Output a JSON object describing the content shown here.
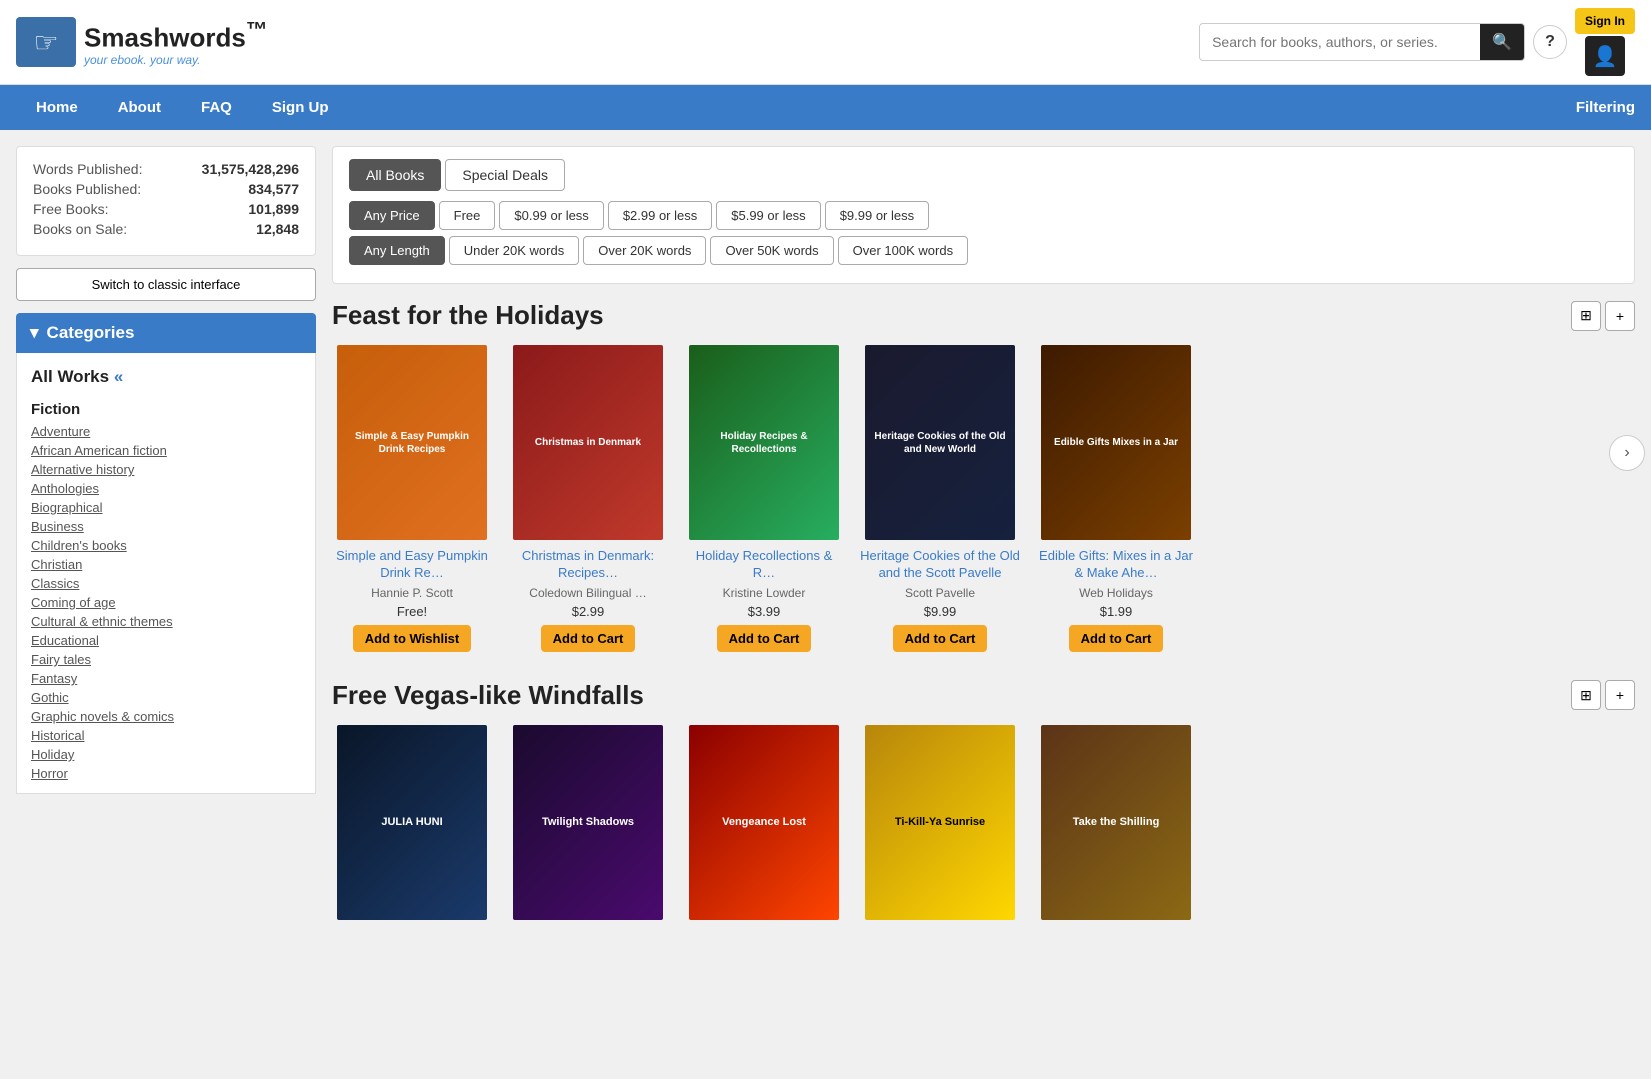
{
  "logo": {
    "title": "Smashwords",
    "tm": "™",
    "subtitle": "your ebook. your way."
  },
  "header": {
    "search_placeholder": "Search for books, authors, or series.",
    "signin_label": "Sign In"
  },
  "nav": {
    "items": [
      {
        "label": "Home",
        "id": "home"
      },
      {
        "label": "About",
        "id": "about"
      },
      {
        "label": "FAQ",
        "id": "faq"
      },
      {
        "label": "Sign Up",
        "id": "signup"
      }
    ],
    "right_label": "Filtering"
  },
  "sidebar": {
    "stats": [
      {
        "label": "Words Published:",
        "value": "31,575,428,296"
      },
      {
        "label": "Books Published:",
        "value": "834,577"
      },
      {
        "label": "Free Books:",
        "value": "101,899"
      },
      {
        "label": "Books on Sale:",
        "value": "12,848"
      }
    ],
    "classic_btn": "Switch to classic interface",
    "categories_title": "Categories",
    "all_works": "All Works «",
    "fiction_label": "Fiction",
    "categories": [
      "Adventure",
      "African American fiction",
      "Alternative history",
      "Anthologies",
      "Biographical",
      "Business",
      "Children's books",
      "Christian",
      "Classics",
      "Coming of age",
      "Cultural & ethnic themes",
      "Educational",
      "Fairy tales",
      "Fantasy",
      "Gothic",
      "Graphic novels & comics",
      "Historical",
      "Holiday",
      "Horror"
    ]
  },
  "filters": {
    "tabs": [
      {
        "label": "All Books",
        "active": true
      },
      {
        "label": "Special Deals",
        "active": false
      }
    ],
    "price": [
      {
        "label": "Any Price",
        "active": true
      },
      {
        "label": "Free",
        "active": false
      },
      {
        "label": "$0.99 or less",
        "active": false
      },
      {
        "label": "$2.99 or less",
        "active": false
      },
      {
        "label": "$5.99 or less",
        "active": false
      },
      {
        "label": "$9.99 or less",
        "active": false
      }
    ],
    "length": [
      {
        "label": "Any Length",
        "active": true
      },
      {
        "label": "Under 20K words",
        "active": false
      },
      {
        "label": "Over 20K words",
        "active": false
      },
      {
        "label": "Over 50K words",
        "active": false
      },
      {
        "label": "Over 100K words",
        "active": false
      }
    ]
  },
  "sections": [
    {
      "id": "feast-holidays",
      "title": "Feast for the Holidays",
      "books": [
        {
          "title": "Simple and Easy Pumpkin Drink Re…",
          "author": "Hannie P. Scott",
          "price": "Free!",
          "btn": "Add to Wishlist",
          "cover_class": "cover-orange",
          "cover_text": "Simple & Easy Pumpkin Drink Recipes"
        },
        {
          "title": "Christmas in Denmark: Recipes…",
          "author": "Coledown Bilingual …",
          "price": "$2.99",
          "btn": "Add to Cart",
          "cover_class": "cover-red",
          "cover_text": "Christmas in Denmark"
        },
        {
          "title": "Holiday Recollections & R…",
          "author": "Kristine Lowder",
          "price": "$3.99",
          "btn": "Add to Cart",
          "cover_class": "cover-green",
          "cover_text": "Holiday Recipes & Recollections"
        },
        {
          "title": "Heritage Cookies of the Old and the Scott Pavelle",
          "author": "Scott Pavelle",
          "price": "$9.99",
          "btn": "Add to Cart",
          "cover_class": "cover-dark",
          "cover_text": "Heritage Cookies of the Old and New World"
        },
        {
          "title": "Edible Gifts: Mixes in a Jar & Make Ahe…",
          "author": "Web Holidays",
          "price": "$1.99",
          "btn": "Add to Cart",
          "cover_class": "cover-brown",
          "cover_text": "Edible Gifts Mixes in a Jar"
        }
      ]
    },
    {
      "id": "free-vegas",
      "title": "Free Vegas-like Windfalls",
      "books": [
        {
          "title": "Julia Huni",
          "author": "",
          "price": "",
          "btn": "",
          "cover_class": "cover-blue-dark",
          "cover_text": "Julia Huni"
        },
        {
          "title": "Twilight Shadows",
          "author": "",
          "price": "",
          "btn": "",
          "cover_class": "cover-purple",
          "cover_text": "Twilight Shadows"
        },
        {
          "title": "Vengeance Lost",
          "author": "",
          "price": "",
          "btn": "",
          "cover_class": "cover-flame",
          "cover_text": "Vengeance Lost"
        },
        {
          "title": "Ti-Kill-Ya Sunrise",
          "author": "",
          "price": "",
          "btn": "",
          "cover_class": "cover-yellow",
          "cover_text": "Ti-Kill-Ya Sunrise"
        },
        {
          "title": "Take the Shilling",
          "author": "",
          "price": "",
          "btn": "",
          "cover_class": "cover-sepia",
          "cover_text": "Take the Shilling"
        }
      ]
    }
  ]
}
